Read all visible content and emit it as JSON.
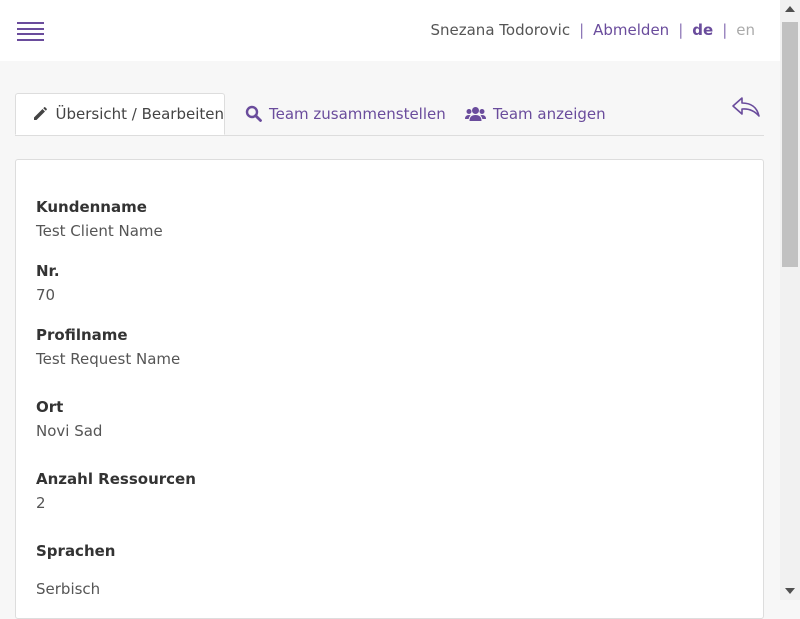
{
  "header": {
    "user_name": "Snezana Todorovic",
    "logout_label": "Abmelden",
    "lang_de": "de",
    "lang_en": "en",
    "separator": "|"
  },
  "tabs": [
    {
      "label": "Übersicht / Bearbeiten",
      "icon": "pencil-icon",
      "active": true
    },
    {
      "label": "Team zusammenstellen",
      "icon": "search-icon",
      "active": false
    },
    {
      "label": "Team anzeigen",
      "icon": "users-icon",
      "active": false
    }
  ],
  "fields": [
    {
      "label": "Kundenname",
      "value": "Test Client Name"
    },
    {
      "label": "Nr.",
      "value": "70"
    },
    {
      "label": "Profilname",
      "value": "Test Request Name"
    },
    {
      "label": "Ort",
      "value": "Novi Sad"
    },
    {
      "label": "Anzahl Ressourcen",
      "value": "2"
    },
    {
      "label": "Sprachen",
      "value": "Serbisch"
    }
  ],
  "colors": {
    "accent": "#6a4c9c",
    "background": "#f7f7f7",
    "panel": "#ffffff"
  }
}
